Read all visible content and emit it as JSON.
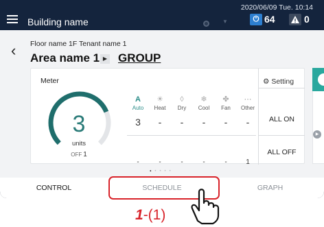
{
  "header": {
    "building_name": "Building name",
    "datetime": "2020/06/09 Tue. 10:14",
    "power_count": "64",
    "warning_count": "0"
  },
  "area": {
    "floor_tenant": "Floor name 1F Tenant name 1",
    "area_name": "Area name 1",
    "group_link": "GROUP"
  },
  "meter": {
    "label": "Meter",
    "units_value": "3",
    "units_label": "units",
    "off_label": "OFF",
    "off_count": "1",
    "gauge_fraction": 0.75
  },
  "modes": [
    {
      "name": "Auto",
      "icon": "A",
      "on_count": "3",
      "off_count": "-",
      "active": true
    },
    {
      "name": "Heat",
      "icon": "☀",
      "on_count": "-",
      "off_count": "-",
      "active": false
    },
    {
      "name": "Dry",
      "icon": "◊",
      "on_count": "-",
      "off_count": "-",
      "active": false
    },
    {
      "name": "Cool",
      "icon": "❄",
      "on_count": "-",
      "off_count": "-",
      "active": false
    },
    {
      "name": "Fan",
      "icon": "✤",
      "on_count": "-",
      "off_count": "-",
      "active": false
    },
    {
      "name": "Other",
      "icon": "⋯",
      "on_count": "-",
      "off_count": "1",
      "active": false
    }
  ],
  "actions": {
    "setting_label": "Setting",
    "all_on_label": "ALL ON",
    "all_off_label": "ALL OFF"
  },
  "tabs": [
    {
      "label": "CONTROL",
      "selected": true
    },
    {
      "label": "SCHEDULE",
      "selected": false
    },
    {
      "label": "GRAPH",
      "selected": false
    }
  ],
  "callout": {
    "step_number": "1",
    "step_suffix": "-(1)"
  },
  "colors": {
    "accent": "#2a8c88",
    "highlight": "#d8232a",
    "header_bg": "#14243d"
  }
}
